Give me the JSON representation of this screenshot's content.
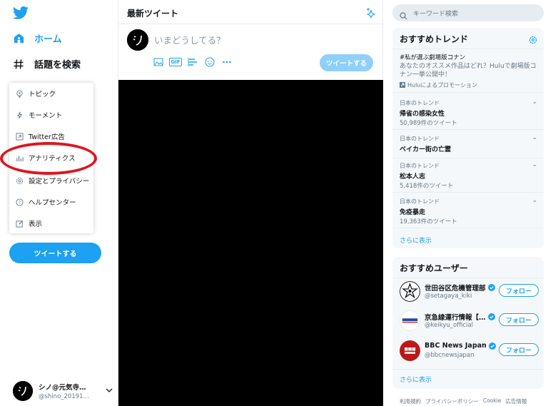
{
  "colors": {
    "accent": "#1da1f2",
    "accent_disabled": "#8ed0f9",
    "highlight": "#e0141e",
    "text": "#14171a",
    "muted": "#657786"
  },
  "sidebar": {
    "logo_icon": "twitter-bird-icon",
    "nav": [
      {
        "label": "ホーム",
        "icon": "home-icon"
      },
      {
        "label": "話題を検索",
        "icon": "hashtag-icon"
      }
    ],
    "menu": [
      {
        "label": "トピック",
        "icon": "topic-icon"
      },
      {
        "label": "モーメント",
        "icon": "lightning-icon"
      },
      {
        "label": "Twitter広告",
        "icon": "external-link-icon"
      },
      {
        "label": "アナリティクス",
        "icon": "bar-chart-icon"
      },
      {
        "label": "設定とプライバシー",
        "icon": "gear-icon"
      },
      {
        "label": "ヘルプセンター",
        "icon": "question-icon"
      },
      {
        "label": "表示",
        "icon": "edit-icon"
      }
    ],
    "tweet_button": "ツイートする",
    "profile": {
      "name": "シノ@元気寺…",
      "handle": "@shino_20191…",
      "avatar_glyph": "シノ"
    }
  },
  "center": {
    "title": "最新ツイート",
    "composer": {
      "placeholder": "いまどうしてる？",
      "tweet_button": "ツイートする",
      "tools": [
        "image-icon",
        "gif-icon",
        "poll-icon",
        "emoji-icon",
        "more-icon"
      ],
      "gif_label": "GIF"
    }
  },
  "right": {
    "search_placeholder": "キーワード検索",
    "trends": {
      "title": "おすすめトレンド",
      "promoted": {
        "tag": "#私が選ぶ劇場版コナン",
        "desc": "あなたのオススメ作品はどれ？Huluで劇場版コナン一挙公開中！",
        "promo": "Huluによるプロモーション"
      },
      "items": [
        {
          "context": "日本のトレンド",
          "name": "帰省の感染女性",
          "count": "50,989件のツイート"
        },
        {
          "context": "日本のトレンド",
          "name": "ベイカー街の亡霊",
          "count": ""
        },
        {
          "context": "日本のトレンド",
          "name": "松本人志",
          "count": "5,418件のツイート"
        },
        {
          "context": "日本のトレンド",
          "name": "免疫暴走",
          "count": "19,363件のツイート"
        }
      ],
      "more": "さらに表示"
    },
    "users": {
      "title": "おすすめユーザー",
      "items": [
        {
          "name": "世田谷区危機管理部",
          "handle": "@setagaya_kiki",
          "follow": "フォロー"
        },
        {
          "name": "京急線運行情報【…",
          "handle": "@keikyu_official",
          "follow": "フォロー"
        },
        {
          "name": "BBC News Japan",
          "handle": "@bbcnewsjapan",
          "follow": "フォロー"
        }
      ],
      "more": "さらに表示"
    },
    "footer": [
      "利用規約",
      "プライバシーポリシー",
      "Cookie",
      "広告情報"
    ]
  }
}
